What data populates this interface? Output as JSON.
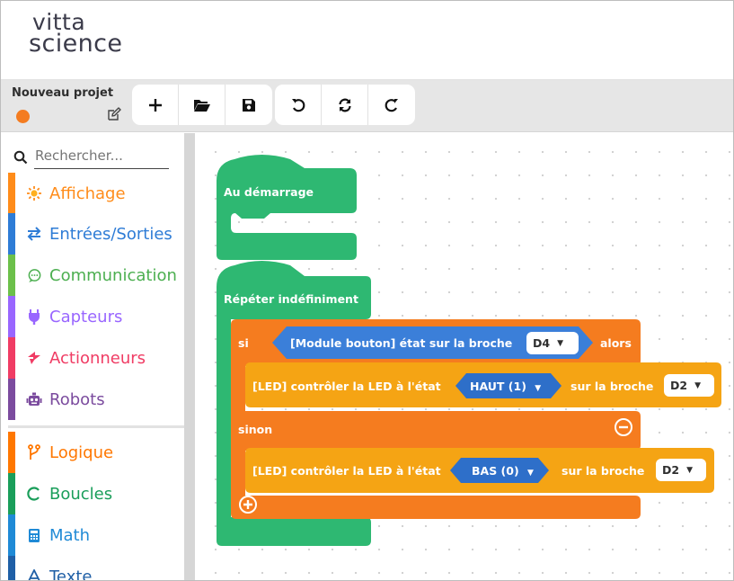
{
  "app": {
    "logo_top": "vitta",
    "logo_bottom": "science"
  },
  "project": {
    "title": "Nouveau projet",
    "status_color": "#f47c20"
  },
  "toolbar": {
    "buttons": [
      {
        "name": "new-button",
        "icon": "plus-icon"
      },
      {
        "name": "open-button",
        "icon": "folder-open-icon"
      },
      {
        "name": "save-button",
        "icon": "floppy-icon"
      },
      {
        "name": "undo-button",
        "icon": "undo-icon"
      },
      {
        "name": "sync-button",
        "icon": "sync-icon"
      },
      {
        "name": "redo-button",
        "icon": "redo-icon"
      }
    ]
  },
  "sidebar": {
    "search_placeholder": "Rechercher...",
    "categories": [
      {
        "label": "Affichage",
        "icon": "sun-icon",
        "color": "#ff8c1a"
      },
      {
        "label": "Entrées/Sorties",
        "icon": "arrows-exchange-icon",
        "color": "#2e7cd6"
      },
      {
        "label": "Communication",
        "icon": "chat-icon",
        "color": "#6cc04a"
      },
      {
        "label": "Capteurs",
        "icon": "plug-icon",
        "color": "#9966ff"
      },
      {
        "label": "Actionneurs",
        "icon": "actuator-icon",
        "color": "#f03c64"
      },
      {
        "label": "Robots",
        "icon": "robot-icon",
        "color": "#7b4b9e"
      },
      {
        "label": "Logique",
        "icon": "logic-branch-icon",
        "color": "#ff7700"
      },
      {
        "label": "Boucles",
        "icon": "loop-icon",
        "color": "#1a9e5a"
      },
      {
        "label": "Math",
        "icon": "calculator-icon",
        "color": "#1f8ad6"
      },
      {
        "label": "Texte",
        "icon": "text-icon",
        "color": "#1f5fa6"
      }
    ]
  },
  "workspace": {
    "start_block": "Au démarrage",
    "forever_block": "Répéter indéfiniment",
    "if_keyword": "si",
    "then_keyword": "alors",
    "else_keyword": "sinon",
    "condition_text": "[Module bouton] état sur la broche",
    "condition_pin": "D4",
    "led_label": "[LED] contrôler la LED à l'état",
    "pin_label": "sur la broche",
    "led1_state": "HAUT (1)",
    "led1_pin": "D2",
    "led2_state": "BAS (0)",
    "led2_pin": "D2",
    "colors": {
      "loop_green": "#2eb872",
      "logic_orange": "#f57c1f",
      "led_orange": "#f5a414",
      "sensor_blue": "#3b7fd9"
    }
  }
}
